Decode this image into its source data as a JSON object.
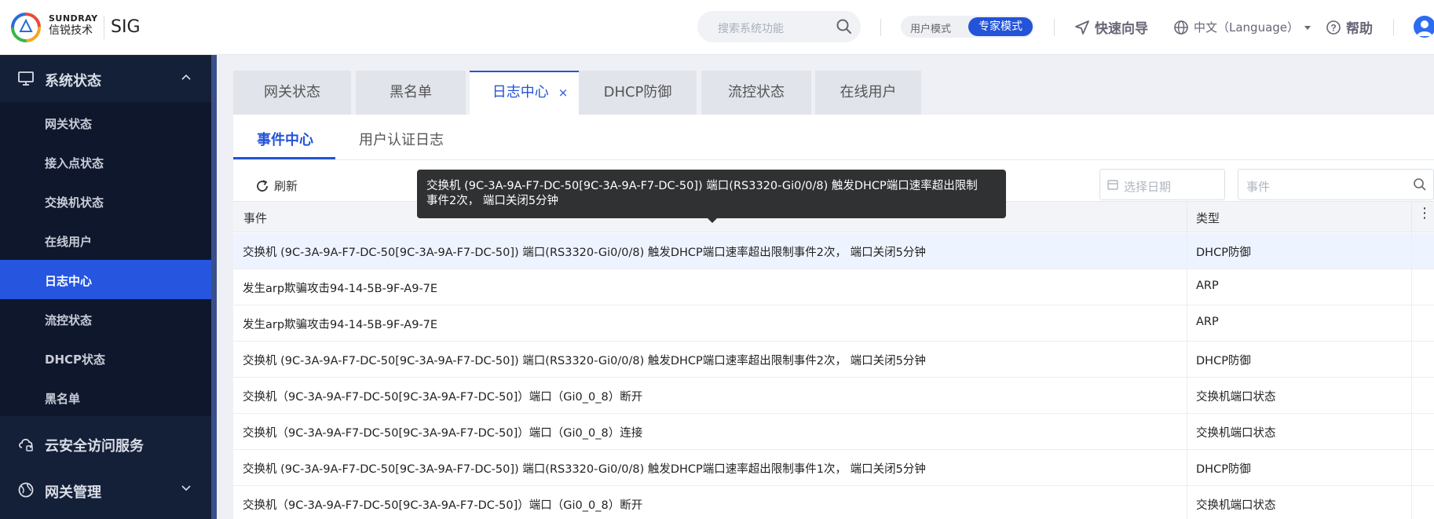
{
  "header": {
    "brand_en": "SUNDRAY",
    "brand_cn": "信锐技术",
    "product": "SIG",
    "search_placeholder": "搜索系统功能",
    "mode_user": "用户模式",
    "mode_expert": "专家模式",
    "quick_guide": "快速向导",
    "language": "中文（Language）",
    "help": "帮助"
  },
  "sidebar": {
    "system_status": "系统状态",
    "items": [
      {
        "label": "网关状态"
      },
      {
        "label": "接入点状态"
      },
      {
        "label": "交换机状态"
      },
      {
        "label": "在线用户"
      },
      {
        "label": "日志中心"
      },
      {
        "label": "流控状态"
      },
      {
        "label": "DHCP状态"
      },
      {
        "label": "黑名单"
      }
    ],
    "cloud_security": "云安全访问服务",
    "gateway_mgmt": "网关管理"
  },
  "tabs": [
    {
      "label": "网关状态"
    },
    {
      "label": "黑名单"
    },
    {
      "label": "日志中心"
    },
    {
      "label": "DHCP防御"
    },
    {
      "label": "流控状态"
    },
    {
      "label": "在线用户"
    }
  ],
  "tab_close": "×",
  "subtabs": {
    "event_center": "事件中心",
    "auth_log": "用户认证日志"
  },
  "toolbar": {
    "refresh": "刷新",
    "date_placeholder": "选择日期",
    "event_placeholder": "事件"
  },
  "table": {
    "col_event": "事件",
    "col_type": "类型",
    "col_more": "⋮",
    "rows": [
      {
        "event": "交换机 (9C-3A-9A-F7-DC-50[9C-3A-9A-F7-DC-50]) 端口(RS3320-Gi0/0/8) 触发DHCP端口速率超出限制事件2次， 端口关闭5分钟",
        "type": "DHCP防御"
      },
      {
        "event": "发生arp欺骗攻击94-14-5B-9F-A9-7E",
        "type": "ARP"
      },
      {
        "event": "发生arp欺骗攻击94-14-5B-9F-A9-7E",
        "type": "ARP"
      },
      {
        "event": "交换机 (9C-3A-9A-F7-DC-50[9C-3A-9A-F7-DC-50]) 端口(RS3320-Gi0/0/8) 触发DHCP端口速率超出限制事件2次， 端口关闭5分钟",
        "type": "DHCP防御"
      },
      {
        "event": "交换机（9C-3A-9A-F7-DC-50[9C-3A-9A-F7-DC-50]）端口（Gi0_0_8）断开",
        "type": "交换机端口状态"
      },
      {
        "event": "交换机（9C-3A-9A-F7-DC-50[9C-3A-9A-F7-DC-50]）端口（Gi0_0_8）连接",
        "type": "交换机端口状态"
      },
      {
        "event": "交换机 (9C-3A-9A-F7-DC-50[9C-3A-9A-F7-DC-50]) 端口(RS3320-Gi0/0/8) 触发DHCP端口速率超出限制事件1次， 端口关闭5分钟",
        "type": "DHCP防御"
      },
      {
        "event": "交换机（9C-3A-9A-F7-DC-50[9C-3A-9A-F7-DC-50]）端口（Gi0_0_8）断开",
        "type": "交换机端口状态"
      }
    ]
  },
  "tooltip": {
    "line1": "交换机 (9C-3A-9A-F7-DC-50[9C-3A-9A-F7-DC-50]) 端口(RS3320-Gi0/0/8) 触发DHCP端口速率超出限制",
    "line2": "事件2次， 端口关闭5分钟"
  },
  "colors": {
    "accent": "#2353d8",
    "sidebar": "#141f38",
    "tooltip": "#303133"
  }
}
